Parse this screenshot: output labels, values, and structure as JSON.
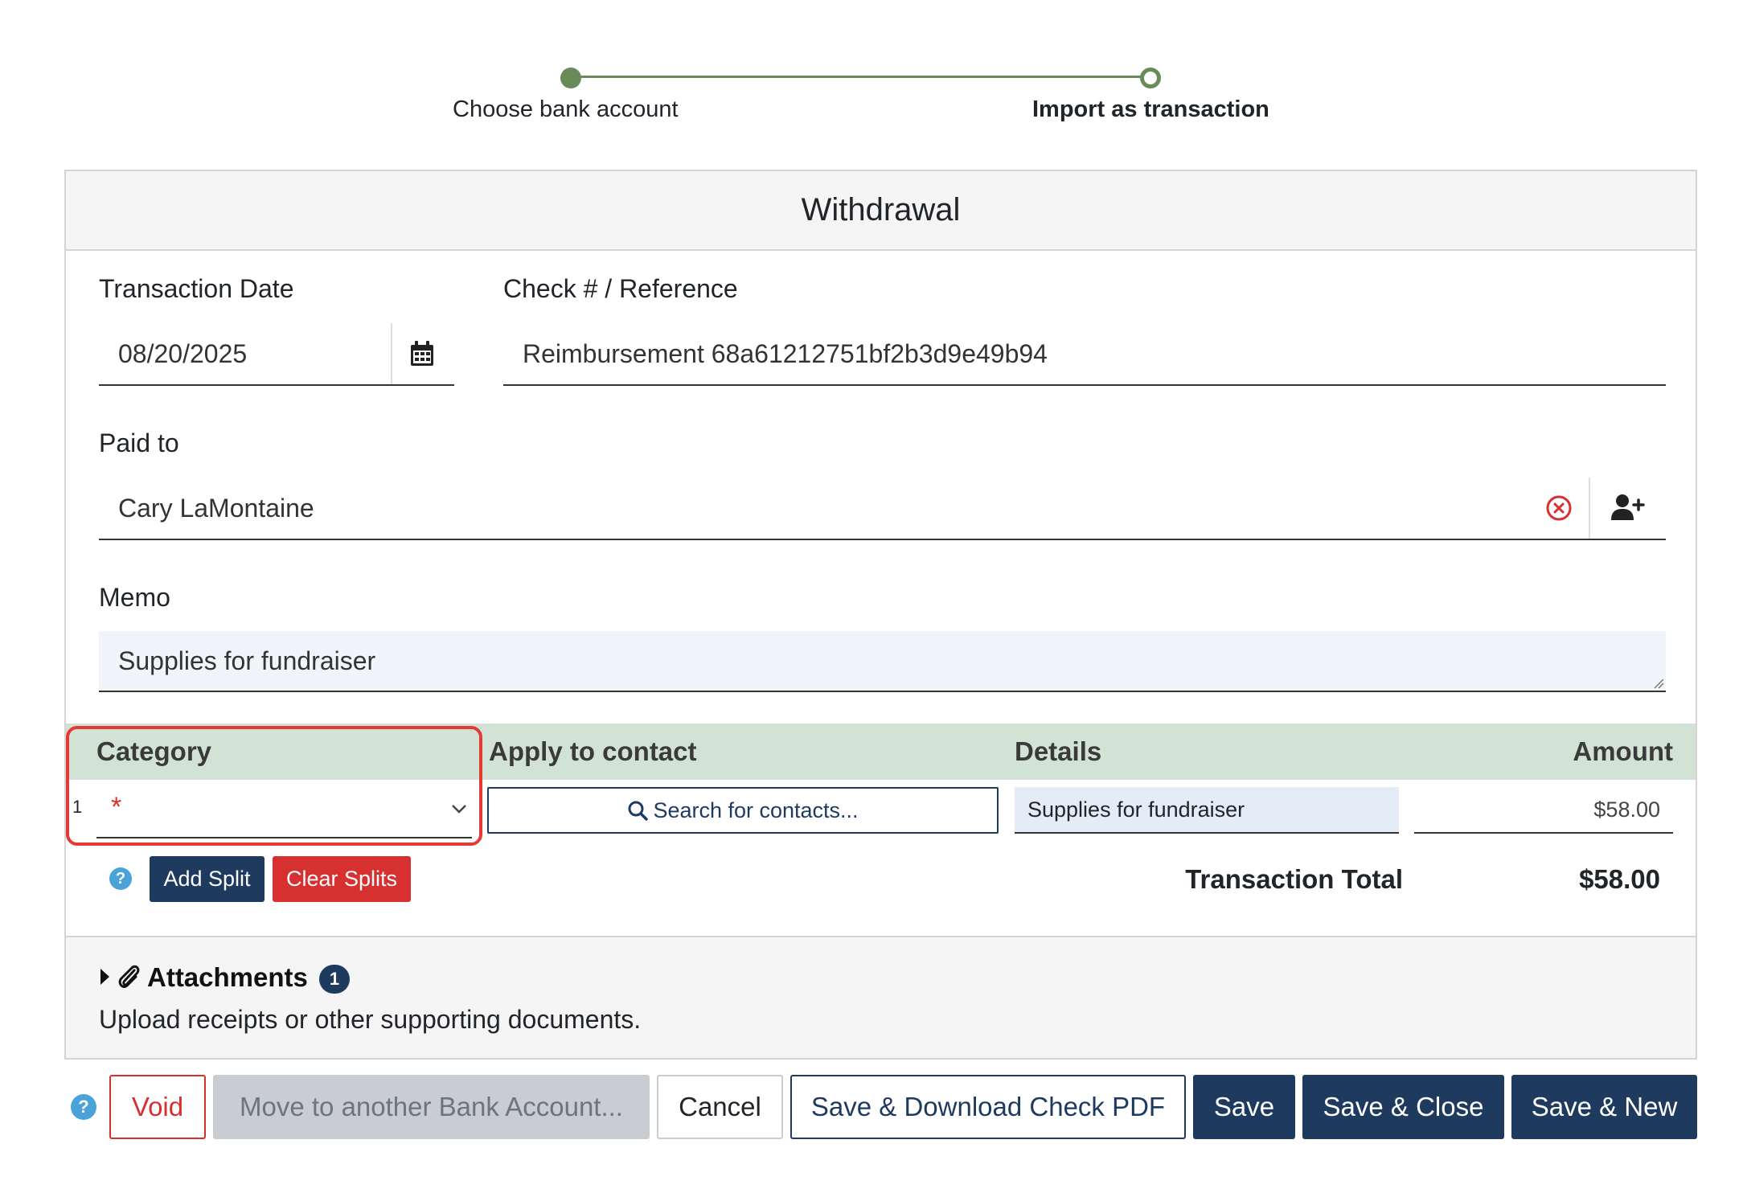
{
  "stepper": {
    "steps": [
      {
        "label": "Choose bank account",
        "state": "done"
      },
      {
        "label": "Import as transaction",
        "state": "current"
      }
    ],
    "color": "#6b8a5a"
  },
  "form": {
    "title": "Withdrawal",
    "transaction_date": {
      "label": "Transaction Date",
      "value": "08/20/2025",
      "icon": "calendar-icon"
    },
    "reference": {
      "label": "Check # / Reference",
      "value": "Reimbursement 68a61212751bf2b3d9e49b94"
    },
    "paid_to": {
      "label": "Paid to",
      "value": "Cary LaMontaine",
      "icons": [
        "clear-circle-icon",
        "add-person-icon"
      ]
    },
    "memo": {
      "label": "Memo",
      "value": "Supplies for fundraiser"
    }
  },
  "splits": {
    "columns": {
      "category": "Category",
      "contact": "Apply to contact",
      "details": "Details",
      "amount": "Amount"
    },
    "rows": [
      {
        "index": "1",
        "category_required": "*",
        "contact_placeholder": "Search for contacts...",
        "details": "Supplies for fundraiser",
        "amount": "$58.00"
      }
    ],
    "help": "?",
    "add_split": "Add Split",
    "clear_splits": "Clear Splits",
    "total_label": "Transaction Total",
    "total_value": "$58.00"
  },
  "attachments": {
    "title": "Attachments",
    "count": "1",
    "description": "Upload receipts or other supporting documents."
  },
  "footer": {
    "help": "?",
    "void": "Void",
    "move": "Move to another Bank Account...",
    "cancel": "Cancel",
    "save_download": "Save & Download Check PDF",
    "save": "Save",
    "save_close": "Save & Close",
    "save_new": "Save & New"
  },
  "colors": {
    "accent": "#1e3a5f",
    "danger": "#d63031",
    "table_header": "#d2e3d5",
    "highlight": "#e53935"
  }
}
